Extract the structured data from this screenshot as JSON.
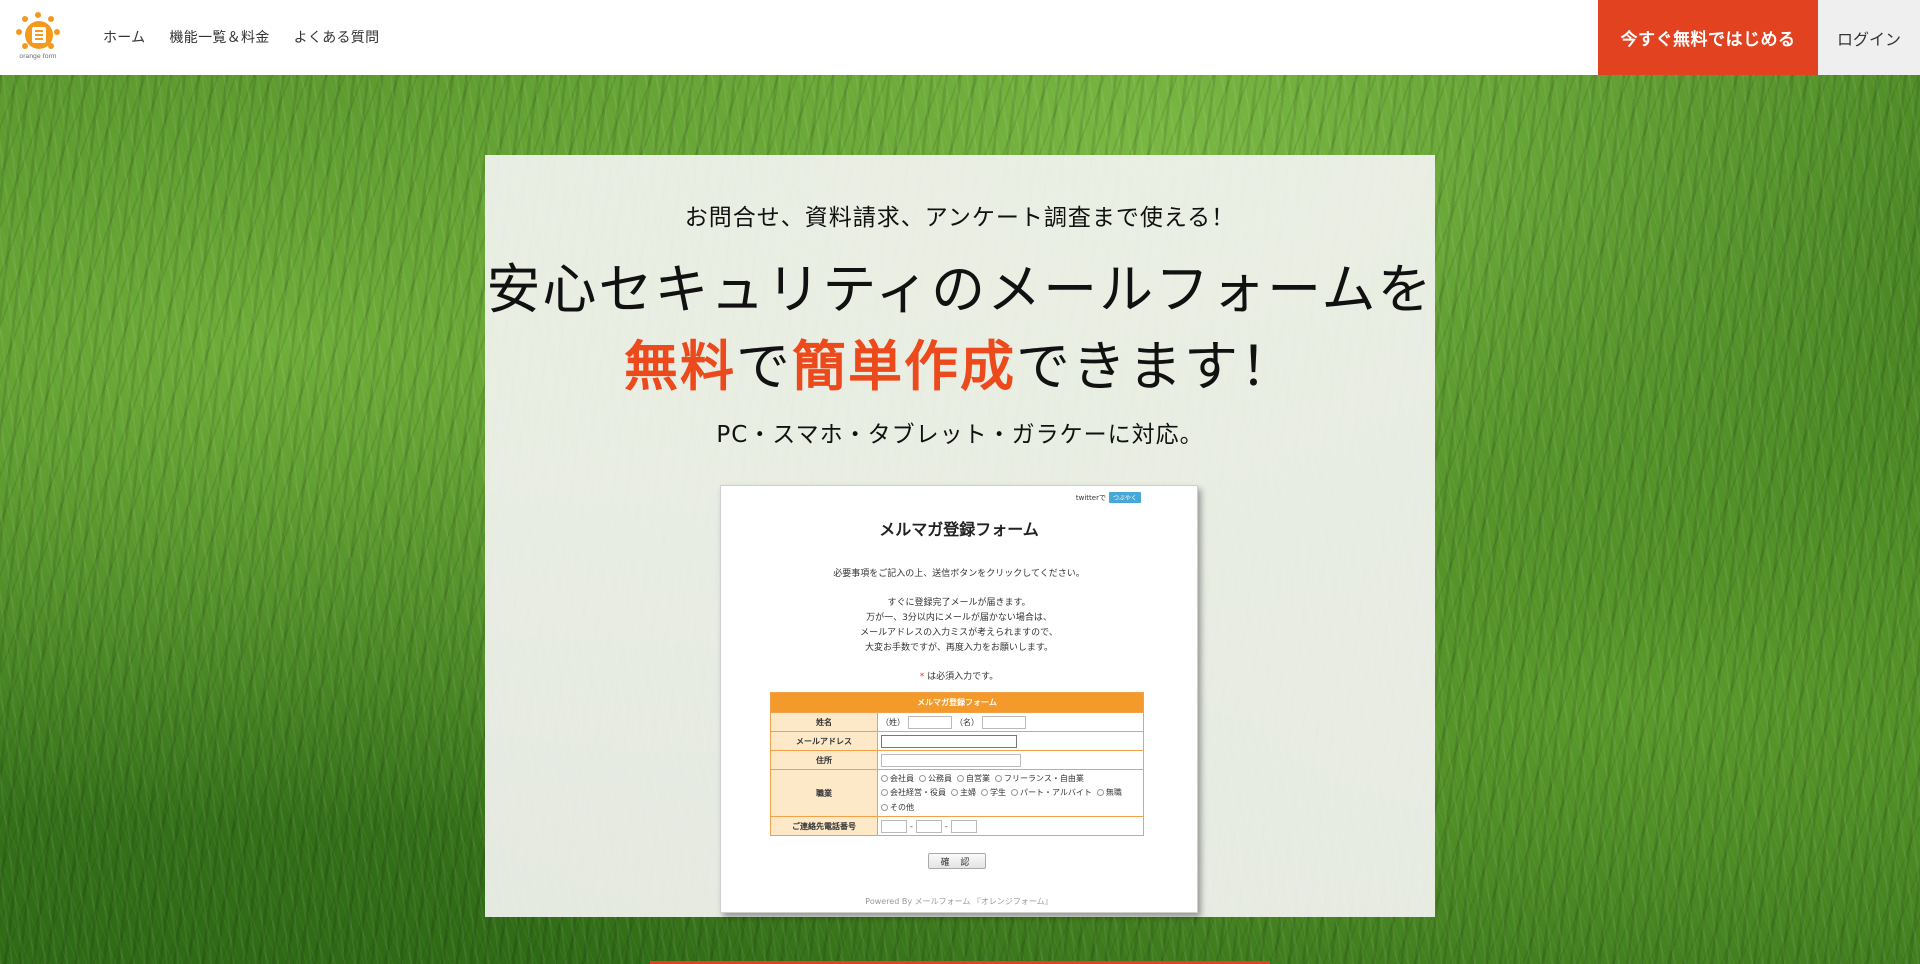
{
  "header": {
    "logo_text": "orange form",
    "nav": [
      "ホーム",
      "機能一覧＆料金",
      "よくある質問"
    ],
    "cta_label": "今すぐ無料ではじめる",
    "login_label": "ログイン",
    "accent_color": "#e2421f"
  },
  "hero": {
    "eyebrow": "お問合せ、資料請求、アンケート調査まで使える！",
    "headline_line1": "安心セキュリティのメールフォームを",
    "headline_free": "無料",
    "headline_de": "で",
    "headline_easy": "簡単作成",
    "headline_end": "できます！",
    "subline": "PC・スマホ・タブレット・ガラケーに対応。",
    "highlight_color": "#ec4a1c"
  },
  "sample_form": {
    "twitter_text": "twitterで",
    "twitter_button": "つぶやく",
    "title": "メルマガ登録フォーム",
    "intro": "必要事項をご記入の上、送信ボタンをクリックしてください。",
    "notes": [
      "すぐに登録完了メールが届きます。",
      "万が一、3分以内にメールが届かない場合は、",
      "メールアドレスの入力ミスが考えられますので、",
      "大変お手数ですが、再度入力をお願いします。"
    ],
    "required_mark": "*",
    "required_text": " は必須入力です。",
    "table_header": "メルマガ登録フォーム",
    "rows": {
      "name_label": "姓名",
      "name_last": "（姓）",
      "name_first": "（名）",
      "email_label": "メールアドレス",
      "address_label": "住所",
      "job_label": "職業",
      "phone_label": "ご連絡先電話番号",
      "phone_sep": "-"
    },
    "jobs_line1": [
      "会社員",
      "公務員",
      "自営業",
      "フリーランス・自由業"
    ],
    "jobs_line2": [
      "会社経営・役員",
      "主婦",
      "学生",
      "パート・アルバイト",
      "無職"
    ],
    "jobs_line3": [
      "その他"
    ],
    "confirm_label": "確 認",
    "powered_by": "Powered By メールフォーム 『オレンジフォーム』"
  }
}
